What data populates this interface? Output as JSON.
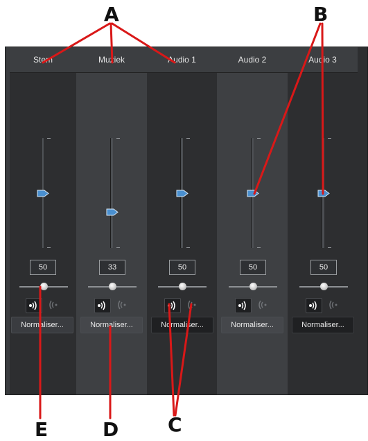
{
  "callouts": {
    "a": "A",
    "b": "B",
    "c": "C",
    "d": "D",
    "e": "E"
  },
  "channels": [
    {
      "name": "Stem",
      "volume": "50",
      "normalize": "Normaliser...",
      "fader_level": 0.5,
      "pan": 0.5
    },
    {
      "name": "Muziek",
      "volume": "33",
      "normalize": "Normaliser...",
      "fader_level": 0.33,
      "pan": 0.5
    },
    {
      "name": "Audio 1",
      "volume": "50",
      "normalize": "Normaliser...",
      "fader_level": 0.5,
      "pan": 0.5
    },
    {
      "name": "Audio 2",
      "volume": "50",
      "normalize": "Normaliser...",
      "fader_level": 0.5,
      "pan": 0.5
    },
    {
      "name": "Audio 3",
      "volume": "50",
      "normalize": "Normaliser...",
      "fader_level": 0.5,
      "pan": 0.5
    }
  ],
  "icons": {
    "solo_on": "speaker-on-icon",
    "solo_off": "speaker-off-icon"
  },
  "colors": {
    "fader_thumb": "#4a90d0",
    "callout_line": "#d91818"
  }
}
